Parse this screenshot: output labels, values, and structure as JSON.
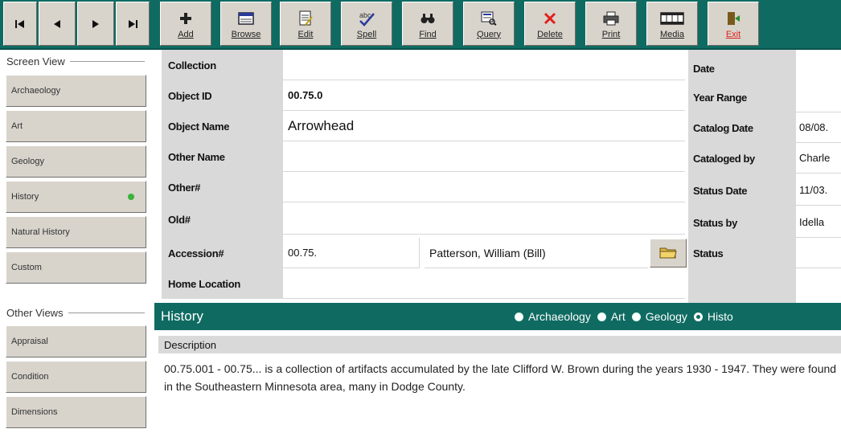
{
  "toolbar": {
    "nav": [
      "first-record",
      "previous-record",
      "next-record",
      "last-record"
    ],
    "buttons": [
      {
        "label": "Add",
        "icon": "plus-icon"
      },
      {
        "label": "Browse",
        "icon": "browse-icon"
      },
      {
        "label": "Edit",
        "icon": "edit-icon"
      },
      {
        "label": "Spell",
        "icon": "spell-check-icon"
      },
      {
        "label": "Find",
        "icon": "binoculars-icon"
      },
      {
        "label": "Query",
        "icon": "query-icon"
      },
      {
        "label": "Delete",
        "icon": "delete-x-icon"
      },
      {
        "label": "Print",
        "icon": "printer-icon"
      },
      {
        "label": "Media",
        "icon": "film-icon"
      },
      {
        "label": "Exit",
        "icon": "exit-door-icon"
      }
    ]
  },
  "sidebar": {
    "screen_view_title": "Screen View",
    "screen_views": [
      "Archaeology",
      "Art",
      "Geology",
      "History",
      "Natural History",
      "Custom"
    ],
    "active_view": "History",
    "other_views_title": "Other Views",
    "other_views": [
      "Appraisal",
      "Condition",
      "Dimensions"
    ]
  },
  "form": {
    "left_labels": [
      "Collection",
      "Object ID",
      "Object Name",
      "Other Name",
      "Other#",
      "Old#",
      "Accession#",
      "Home Location"
    ],
    "left_values": [
      "",
      "00.75.0",
      "Arrowhead",
      "",
      "",
      "",
      "00.75.",
      ""
    ],
    "accession_donor": "Patterson, William (Bill)",
    "right_labels": [
      "Date",
      "Year Range",
      "Catalog Date",
      "Cataloged by",
      "Status Date",
      "Status by",
      "Status"
    ],
    "right_values": [
      "",
      "",
      "08/08.",
      "Charle",
      "11/03.",
      "Idella",
      ""
    ]
  },
  "band": {
    "title": "History",
    "radios": [
      {
        "label": "Archaeology",
        "selected": false
      },
      {
        "label": "Art",
        "selected": false
      },
      {
        "label": "Geology",
        "selected": false
      },
      {
        "label": "Histo",
        "selected": true
      }
    ]
  },
  "description": {
    "header": "Description",
    "text": "00.75.001 - 00.75...  is a collection of artifacts accumulated by the late Clifford W. Brown during the years 1930 - 1947. They were found in the Southeastern Minnesota area, many in Dodge County."
  },
  "colors": {
    "teal": "#0f6b62",
    "button_face": "#d8d4cc",
    "label_gray": "#d9d9d9",
    "active_dot": "#3bb33b",
    "delete_red": "#e0201c"
  }
}
